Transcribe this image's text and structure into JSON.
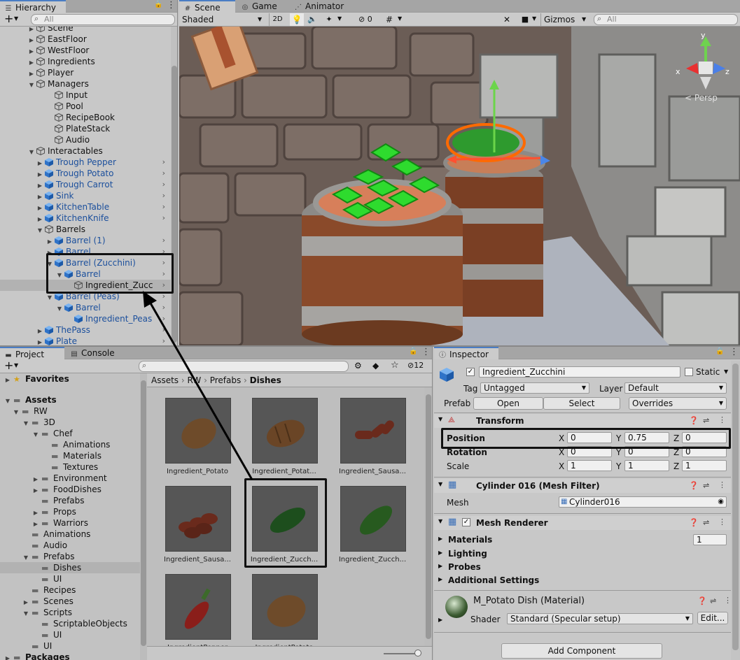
{
  "hierarchy": {
    "tab_label": "Hierarchy",
    "search_placeholder": "All",
    "rows": [
      {
        "label": "Scene",
        "color": "black"
      },
      {
        "label": "EastFloor",
        "color": "black"
      },
      {
        "label": "WestFloor",
        "color": "black"
      },
      {
        "label": "Ingredients",
        "color": "black"
      },
      {
        "label": "Player",
        "color": "black"
      },
      {
        "label": "Managers",
        "color": "black"
      },
      {
        "label": "Input",
        "color": "black"
      },
      {
        "label": "Pool",
        "color": "black"
      },
      {
        "label": "RecipeBook",
        "color": "black"
      },
      {
        "label": "PlateStack",
        "color": "black"
      },
      {
        "label": "Audio",
        "color": "black"
      },
      {
        "label": "Interactables",
        "color": "black"
      },
      {
        "label": "Trough Pepper",
        "color": "blue"
      },
      {
        "label": "Trough Potato",
        "color": "blue"
      },
      {
        "label": "Trough Carrot",
        "color": "blue"
      },
      {
        "label": "Sink",
        "color": "blue"
      },
      {
        "label": "KitchenTable",
        "color": "blue"
      },
      {
        "label": "KitchenKnife",
        "color": "blue"
      },
      {
        "label": "Barrels",
        "color": "black"
      },
      {
        "label": "Barrel (1)",
        "color": "blue"
      },
      {
        "label": "Barrel",
        "color": "blue"
      },
      {
        "label": "Barrel (Zucchini)",
        "color": "blue"
      },
      {
        "label": "Barrel",
        "color": "blue"
      },
      {
        "label": "Ingredient_Zucc",
        "color": "black"
      },
      {
        "label": "Barrel (Peas)",
        "color": "blue"
      },
      {
        "label": "Barrel",
        "color": "blue"
      },
      {
        "label": "Ingredient_Peas",
        "color": "blue"
      },
      {
        "label": "ThePass",
        "color": "blue"
      },
      {
        "label": "Plate",
        "color": "blue"
      }
    ]
  },
  "scene": {
    "tabs": [
      {
        "label": "Scene",
        "icon": "hash-icon"
      },
      {
        "label": "Game",
        "icon": "gamepad-icon"
      },
      {
        "label": "Animator",
        "icon": "animator-icon"
      }
    ],
    "shading_mode": "Shaded",
    "mode_2d": "2D",
    "hidden_count": "0",
    "gizmos_label": "Gizmos",
    "search_placeholder": "All",
    "gizmo_axes": {
      "x": "x",
      "y": "y",
      "z": "z"
    },
    "persp_label": "< Persp"
  },
  "project": {
    "tabs": [
      {
        "label": "Project",
        "icon": "folder-icon"
      },
      {
        "label": "Console",
        "icon": "console-icon"
      }
    ],
    "hidden_count": "12",
    "tree": [
      {
        "label": "Favorites",
        "bold": true
      },
      {
        "label": "Assets",
        "bold": true
      },
      {
        "label": "RW",
        "bold": false
      },
      {
        "label": "3D",
        "bold": false
      },
      {
        "label": "Chef",
        "bold": false
      },
      {
        "label": "Animations",
        "bold": false
      },
      {
        "label": "Materials",
        "bold": false
      },
      {
        "label": "Textures",
        "bold": false
      },
      {
        "label": "Environment",
        "bold": false
      },
      {
        "label": "FoodDishes",
        "bold": false
      },
      {
        "label": "Prefabs",
        "bold": false
      },
      {
        "label": "Props",
        "bold": false
      },
      {
        "label": "Warriors",
        "bold": false
      },
      {
        "label": "Animations",
        "bold": false
      },
      {
        "label": "Audio",
        "bold": false
      },
      {
        "label": "Prefabs",
        "bold": false
      },
      {
        "label": "Dishes",
        "bold": false
      },
      {
        "label": "UI",
        "bold": false
      },
      {
        "label": "Recipes",
        "bold": false
      },
      {
        "label": "Scenes",
        "bold": false
      },
      {
        "label": "Scripts",
        "bold": false
      },
      {
        "label": "ScriptableObjects",
        "bold": false
      },
      {
        "label": "UI",
        "bold": false
      },
      {
        "label": "UI",
        "bold": false
      },
      {
        "label": "Packages",
        "bold": true
      }
    ],
    "breadcrumb": [
      "Assets",
      "RW",
      "Prefabs",
      "Dishes"
    ],
    "assets": [
      {
        "label": "Ingredient_Potato",
        "shape": "potato"
      },
      {
        "label": "Ingredient_Potat...",
        "shape": "sliced-potato"
      },
      {
        "label": "Ingredient_Sausa...",
        "shape": "sausage"
      },
      {
        "label": "Ingredient_Sausa...",
        "shape": "sausage-chain"
      },
      {
        "label": "Ingredient_Zucch...",
        "shape": "zucchini"
      },
      {
        "label": "Ingredient_Zucch...",
        "shape": "zucchini-dark"
      },
      {
        "label": "IngredientPepper",
        "shape": "pepper"
      },
      {
        "label": "IngredientPotato",
        "shape": "potato-2"
      }
    ]
  },
  "inspector": {
    "tab_label": "Inspector",
    "object_name": "Ingredient_Zucchini",
    "static_label": "Static",
    "tag_label": "Tag",
    "tag_value": "Untagged",
    "layer_label": "Layer",
    "layer_value": "Default",
    "prefab_label": "Prefab",
    "open_label": "Open",
    "select_label": "Select",
    "overrides_label": "Overrides",
    "transform": {
      "title": "Transform",
      "position_label": "Position",
      "rotation_label": "Rotation",
      "scale_label": "Scale",
      "x": "X",
      "y": "Y",
      "z": "Z",
      "position": [
        "0",
        "0.75",
        "0"
      ],
      "rotation": [
        "0",
        "0",
        "0"
      ],
      "scale": [
        "1",
        "1",
        "1"
      ]
    },
    "mesh_filter": {
      "title": "Cylinder 016 (Mesh Filter)",
      "mesh_label": "Mesh",
      "mesh_value": "Cylinder016"
    },
    "mesh_renderer": {
      "title": "Mesh Renderer",
      "materials_label": "Materials",
      "materials_count": "1",
      "lighting_label": "Lighting",
      "probes_label": "Probes",
      "additional_label": "Additional Settings"
    },
    "material": {
      "title": "M_Potato Dish (Material)",
      "shader_label": "Shader",
      "shader_value": "Standard (Specular setup)",
      "edit_label": "Edit..."
    },
    "add_component_label": "Add Component"
  },
  "colors": {
    "selection_blue": "#4a7dc4",
    "prefab_blue": "#1b4f9c",
    "panel_bg": "#c2c2c2"
  }
}
